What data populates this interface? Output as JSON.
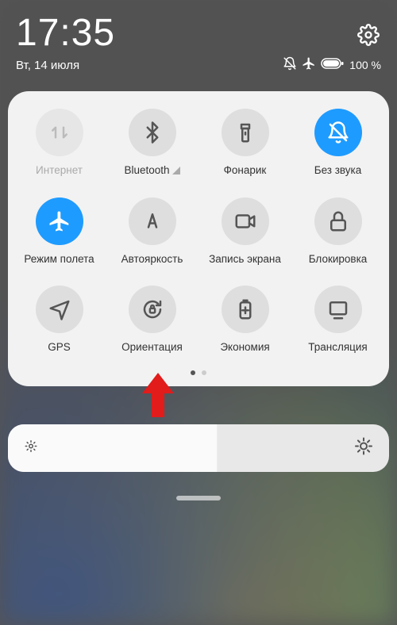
{
  "status": {
    "time": "17:35",
    "date": "Вт, 14 июля",
    "battery_pct": "100 %"
  },
  "tiles": {
    "internet": {
      "label": "Интернет"
    },
    "bluetooth": {
      "label": "Bluetooth"
    },
    "flashlight": {
      "label": "Фонарик"
    },
    "mute": {
      "label": "Без звука"
    },
    "airplane": {
      "label": "Режим полета"
    },
    "autobright": {
      "label": "Автояркость"
    },
    "screenrec": {
      "label": "Запись экрана"
    },
    "lock": {
      "label": "Блокировка"
    },
    "gps": {
      "label": "GPS"
    },
    "orientation": {
      "label": "Ориентация"
    },
    "battery": {
      "label": "Экономия"
    },
    "cast": {
      "label": "Трансляция"
    }
  }
}
